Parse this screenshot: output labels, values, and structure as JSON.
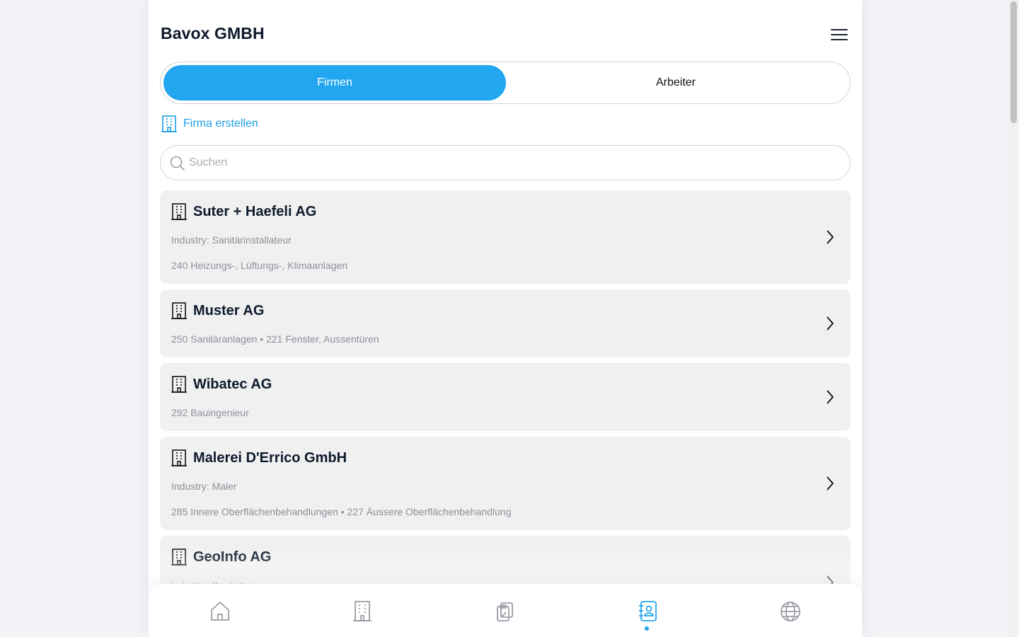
{
  "header": {
    "title": "Bavox GMBH",
    "menu_icon": "hamburger-menu-icon"
  },
  "segment": {
    "tabs": [
      {
        "label": "Firmen",
        "active": true
      },
      {
        "label": "Arbeiter",
        "active": false
      }
    ]
  },
  "create": {
    "label": "Firma erstellen",
    "icon": "building-icon"
  },
  "search": {
    "placeholder": "Suchen",
    "value": ""
  },
  "companies": [
    {
      "name": "Suter + Haefeli AG",
      "lines": [
        "Industry: Sanitärinstallateur",
        "240 Heizungs-, Lüftungs-, Klimaanlagen"
      ]
    },
    {
      "name": "Muster AG",
      "lines": [
        "250 Sanitäranlagen • 221 Fenster, Aussentüren"
      ]
    },
    {
      "name": "Wibatec AG",
      "lines": [
        "292 Bauingenieur"
      ]
    },
    {
      "name": "Malerei D'Errico GmbH",
      "lines": [
        "Industry: Maler",
        "285 Innere Oberflächenbehandlungen • 227 Äussere Oberflächenbehandlung"
      ]
    },
    {
      "name": "GeoInfo AG",
      "lines": [
        "Industry: Bauleiter"
      ]
    }
  ],
  "bottom_nav": {
    "items": [
      {
        "icon": "home-icon",
        "active": false
      },
      {
        "icon": "building-icon",
        "active": false
      },
      {
        "icon": "clipboard-check-icon",
        "active": false
      },
      {
        "icon": "contacts-book-icon",
        "active": true
      },
      {
        "icon": "globe-icon",
        "active": false
      }
    ]
  },
  "colors": {
    "accent": "#22a6ef",
    "card_bg": "#f0f0f1",
    "text_muted": "#8b9099",
    "text_dark": "#0e1a2b"
  }
}
